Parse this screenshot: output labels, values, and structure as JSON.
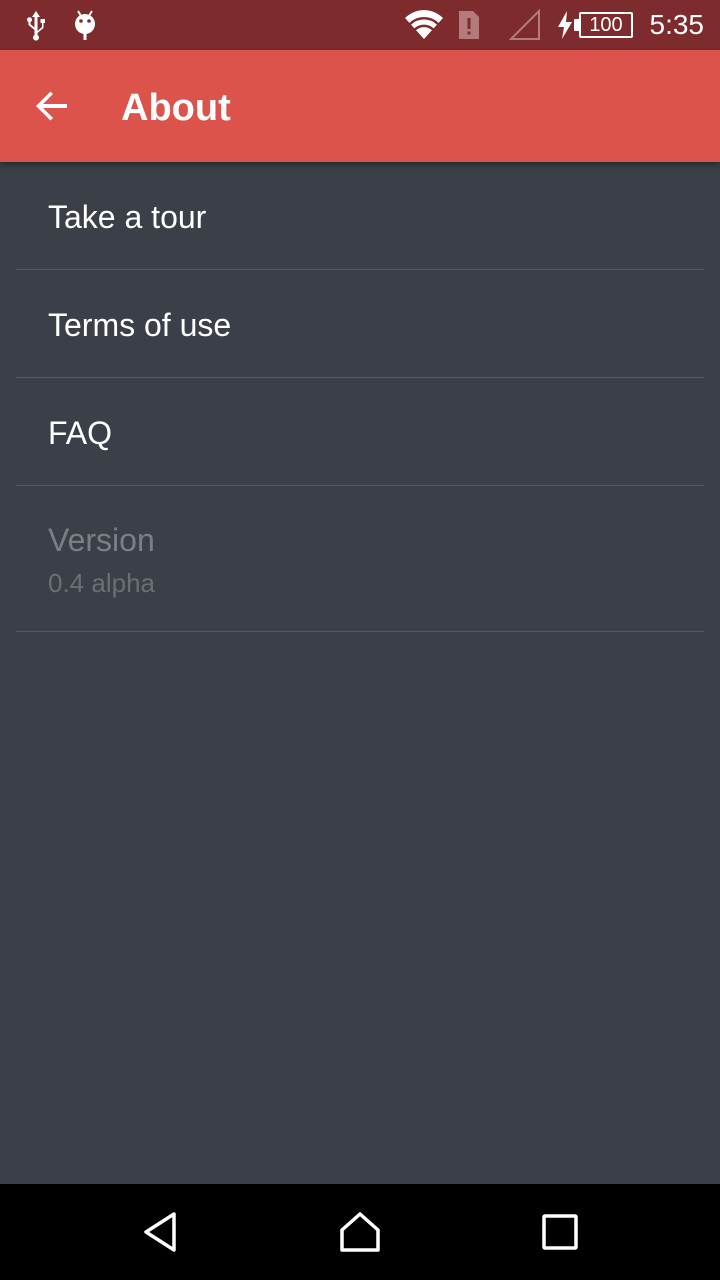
{
  "status_bar": {
    "time": "5:35",
    "battery_level": "100",
    "icons": [
      "usb-icon",
      "android-debug-icon",
      "wifi-icon",
      "sim-alert-icon",
      "signal-icon",
      "charging-icon",
      "battery-icon"
    ],
    "background": "#7d2b2d"
  },
  "app_bar": {
    "title": "About",
    "back_icon": "arrow-back-icon",
    "background": "#dc534c"
  },
  "list": {
    "items": [
      {
        "label": "Take a tour"
      },
      {
        "label": "Terms of use"
      },
      {
        "label": "FAQ"
      }
    ],
    "version": {
      "title": "Version",
      "value": "0.4 alpha"
    }
  },
  "nav_bar": {
    "buttons": [
      "back-icon",
      "home-icon",
      "recents-icon"
    ]
  },
  "colors": {
    "background": "#3b4048",
    "divider": "#555b63",
    "text_primary": "#ffffff",
    "text_disabled": "#7a7f86"
  }
}
